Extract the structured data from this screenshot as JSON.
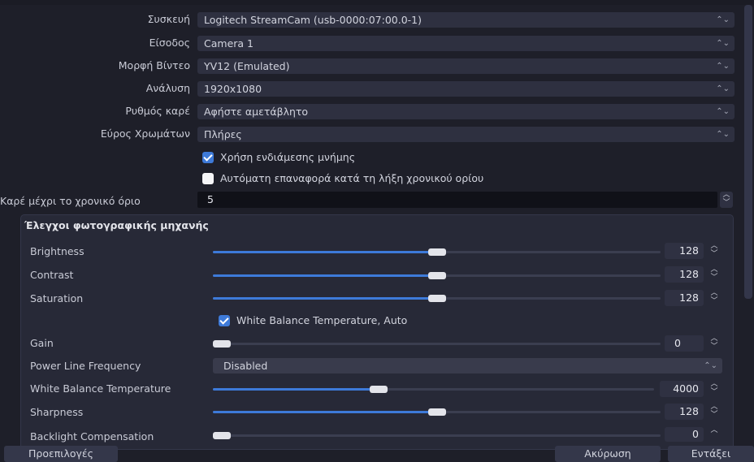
{
  "properties": [
    {
      "label": "Συσκευή",
      "value": "Logitech StreamCam (usb-0000:07:00.0-1)"
    },
    {
      "label": "Είσοδος",
      "value": "Camera 1"
    },
    {
      "label": "Μορφή Βίντεο",
      "value": "YV12 (Emulated)"
    },
    {
      "label": "Ανάλυση",
      "value": "1920x1080"
    },
    {
      "label": "Ρυθμός καρέ",
      "value": "Αφήστε αμετάβλητο"
    },
    {
      "label": "Εύρος Χρωμάτων",
      "value": "Πλήρες"
    }
  ],
  "checkboxes": {
    "buffering": {
      "label": "Χρήση ενδιάμεσης μνήμης",
      "checked": true
    },
    "auto_reset": {
      "label": "Αυτόματη επαναφορά κατά τη λήξη χρονικού ορίου",
      "checked": false
    }
  },
  "timeout": {
    "label": "Καρέ μέχρι το χρονικό όριο",
    "value": "5"
  },
  "camera_controls": {
    "title": "Έλεγχοι φωτογραφικής μηχανής",
    "brightness": {
      "label": "Brightness",
      "value": "128",
      "level": 0.5
    },
    "contrast": {
      "label": "Contrast",
      "value": "128",
      "level": 0.5
    },
    "saturation": {
      "label": "Saturation",
      "value": "128",
      "level": 0.5
    },
    "wb_auto": {
      "label": "White Balance Temperature, Auto",
      "checked": true
    },
    "gain": {
      "label": "Gain",
      "value": "0",
      "level": 0.0
    },
    "power_line": {
      "label": "Power Line Frequency",
      "value": "Disabled"
    },
    "wb_temp": {
      "label": "White Balance Temperature",
      "value": "4000",
      "level": 0.37
    },
    "sharpness": {
      "label": "Sharpness",
      "value": "128",
      "level": 0.5
    },
    "backlight": {
      "label": "Backlight Compensation",
      "value": "0",
      "level": 0.0
    }
  },
  "buttons": {
    "defaults": "Προεπιλογές",
    "cancel": "Ακύρωση",
    "ok": "Εντάξει"
  },
  "colors": {
    "accent": "#3d7ad9",
    "background": "#1e1f29",
    "field": "#2e3040"
  },
  "icons": {
    "combo": "chevron-updown-icon",
    "spin": "spin-arrows-icon",
    "check": "check-icon"
  }
}
